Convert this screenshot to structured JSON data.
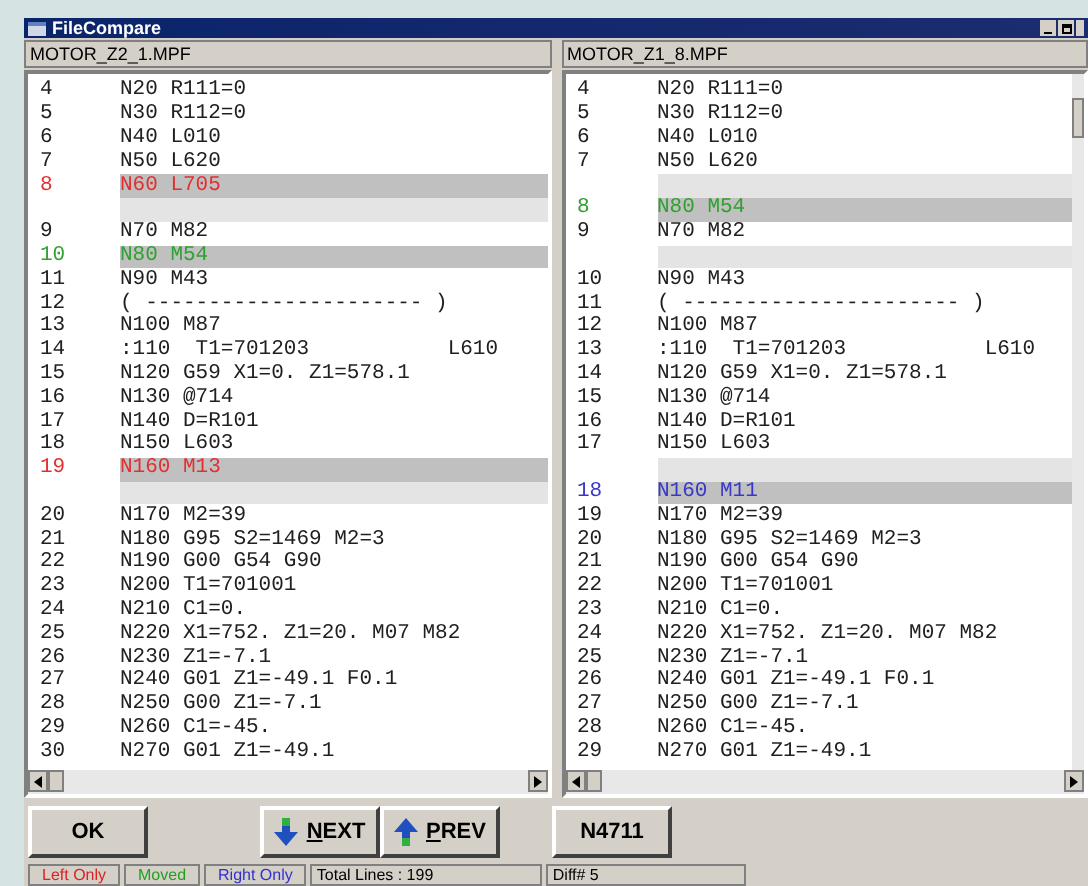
{
  "window": {
    "title": "FileCompare"
  },
  "panes": [
    {
      "file": "MOTOR_Z2_1.MPF",
      "lines": [
        {
          "kind": "same",
          "num": "4",
          "code": "N20 R111=0"
        },
        {
          "kind": "same",
          "num": "5",
          "code": "N30 R112=0"
        },
        {
          "kind": "same",
          "num": "6",
          "code": "N40 L010"
        },
        {
          "kind": "same",
          "num": "7",
          "code": "N50 L620"
        },
        {
          "kind": "left",
          "num": "8",
          "code": "N60 L705"
        },
        {
          "kind": "gap"
        },
        {
          "kind": "same",
          "num": "9",
          "code": "N70 M82"
        },
        {
          "kind": "moved",
          "num": "10",
          "code": "N80 M54"
        },
        {
          "kind": "same",
          "num": "11",
          "code": "N90 M43"
        },
        {
          "kind": "same",
          "num": "12",
          "code": "( ---------------------- )"
        },
        {
          "kind": "same",
          "num": "13",
          "code": "N100 M87"
        },
        {
          "kind": "same",
          "num": "14",
          "code": ":110  T1=701203           L610"
        },
        {
          "kind": "same",
          "num": "15",
          "code": "N120 G59 X1=0. Z1=578.1"
        },
        {
          "kind": "same",
          "num": "16",
          "code": "N130 @714"
        },
        {
          "kind": "same",
          "num": "17",
          "code": "N140 D=R101"
        },
        {
          "kind": "same",
          "num": "18",
          "code": "N150 L603"
        },
        {
          "kind": "left",
          "num": "19",
          "code": "N160 M13"
        },
        {
          "kind": "gap"
        },
        {
          "kind": "same",
          "num": "20",
          "code": "N170 M2=39"
        },
        {
          "kind": "same",
          "num": "21",
          "code": "N180 G95 S2=1469 M2=3"
        },
        {
          "kind": "same",
          "num": "22",
          "code": "N190 G00 G54 G90"
        },
        {
          "kind": "same",
          "num": "23",
          "code": "N200 T1=701001"
        },
        {
          "kind": "same",
          "num": "24",
          "code": "N210 C1=0."
        },
        {
          "kind": "same",
          "num": "25",
          "code": "N220 X1=752. Z1=20. M07 M82"
        },
        {
          "kind": "same",
          "num": "26",
          "code": "N230 Z1=-7.1"
        },
        {
          "kind": "same",
          "num": "27",
          "code": "N240 G01 Z1=-49.1 F0.1"
        },
        {
          "kind": "same",
          "num": "28",
          "code": "N250 G00 Z1=-7.1"
        },
        {
          "kind": "same",
          "num": "29",
          "code": "N260 C1=-45."
        },
        {
          "kind": "same",
          "num": "30",
          "code": "N270 G01 Z1=-49.1"
        }
      ]
    },
    {
      "file": "MOTOR_Z1_8.MPF",
      "lines": [
        {
          "kind": "same",
          "num": "4",
          "code": "N20 R111=0"
        },
        {
          "kind": "same",
          "num": "5",
          "code": "N30 R112=0"
        },
        {
          "kind": "same",
          "num": "6",
          "code": "N40 L010"
        },
        {
          "kind": "same",
          "num": "7",
          "code": "N50 L620"
        },
        {
          "kind": "gap"
        },
        {
          "kind": "moved",
          "num": "8",
          "code": "N80 M54"
        },
        {
          "kind": "same",
          "num": "9",
          "code": "N70 M82"
        },
        {
          "kind": "gap"
        },
        {
          "kind": "same",
          "num": "10",
          "code": "N90 M43"
        },
        {
          "kind": "same",
          "num": "11",
          "code": "( ---------------------- )"
        },
        {
          "kind": "same",
          "num": "12",
          "code": "N100 M87"
        },
        {
          "kind": "same",
          "num": "13",
          "code": ":110  T1=701203           L610"
        },
        {
          "kind": "same",
          "num": "14",
          "code": "N120 G59 X1=0. Z1=578.1"
        },
        {
          "kind": "same",
          "num": "15",
          "code": "N130 @714"
        },
        {
          "kind": "same",
          "num": "16",
          "code": "N140 D=R101"
        },
        {
          "kind": "same",
          "num": "17",
          "code": "N150 L603"
        },
        {
          "kind": "gap"
        },
        {
          "kind": "right",
          "num": "18",
          "code": "N160 M11"
        },
        {
          "kind": "same",
          "num": "19",
          "code": "N170 M2=39"
        },
        {
          "kind": "same",
          "num": "20",
          "code": "N180 G95 S2=1469 M2=3"
        },
        {
          "kind": "same",
          "num": "21",
          "code": "N190 G00 G54 G90"
        },
        {
          "kind": "same",
          "num": "22",
          "code": "N200 T1=701001"
        },
        {
          "kind": "same",
          "num": "23",
          "code": "N210 C1=0."
        },
        {
          "kind": "same",
          "num": "24",
          "code": "N220 X1=752. Z1=20. M07 M82"
        },
        {
          "kind": "same",
          "num": "25",
          "code": "N230 Z1=-7.1"
        },
        {
          "kind": "same",
          "num": "26",
          "code": "N240 G01 Z1=-49.1 F0.1"
        },
        {
          "kind": "same",
          "num": "27",
          "code": "N250 G00 Z1=-7.1"
        },
        {
          "kind": "same",
          "num": "28",
          "code": "N260 C1=-45."
        },
        {
          "kind": "same",
          "num": "29",
          "code": "N270 G01 Z1=-49.1"
        }
      ]
    }
  ],
  "buttons": [
    {
      "kind": "ok",
      "label": "OK",
      "mnemonic": false
    },
    {
      "kind": "next",
      "label": "NEXT",
      "mnemonic": true
    },
    {
      "kind": "prev",
      "label": "PREV",
      "mnemonic": true
    },
    {
      "kind": "goto",
      "label": "N4711",
      "mnemonic": false
    }
  ],
  "status_bar": [
    {
      "kind": "legend",
      "text": "Left Only",
      "color": "#e02020"
    },
    {
      "kind": "legend",
      "text": "Moved",
      "color": "#20a020"
    },
    {
      "kind": "legend",
      "text": "Right Only",
      "color": "#3030d0"
    },
    {
      "kind": "info",
      "text": "Total Lines : 199"
    },
    {
      "kind": "info",
      "text": "Diff# 5"
    }
  ]
}
